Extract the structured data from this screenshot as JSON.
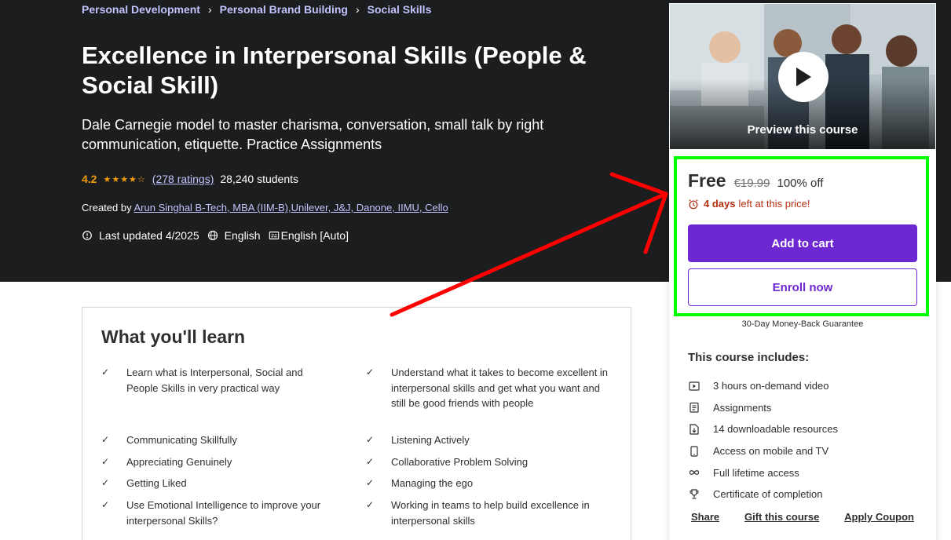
{
  "breadcrumbs": [
    "Personal Development",
    "Personal Brand Building",
    "Social Skills"
  ],
  "course": {
    "title": "Excellence in Interpersonal Skills (People & Social Skill)",
    "subtitle": "Dale Carnegie model to master charisma, conversation, small talk by right communication, etiquette. Practice Assignments",
    "rating": "4.2",
    "stars_value": 4.2,
    "ratings_count": "(278 ratings)",
    "students": "28,240 students",
    "created_by_label": "Created by",
    "instructor": "Arun Singhal B-Tech, MBA (IIM-B),Unilever, J&J, Danone, IIMU, Cello",
    "last_updated": "Last updated 4/2025",
    "language": "English",
    "captions": "English [Auto]"
  },
  "sidebar": {
    "preview_label": "Preview this course",
    "price_now": "Free",
    "price_old": "€19.99",
    "discount": "100% off",
    "timer_bold": "4 days",
    "timer_rest": "left at this price!",
    "add_to_cart": "Add to cart",
    "enroll_now": "Enroll now",
    "guarantee": "30-Day Money-Back Guarantee",
    "includes_title": "This course includes:",
    "includes": [
      {
        "icon": "video-icon",
        "label": "3 hours on-demand video"
      },
      {
        "icon": "assignment-icon",
        "label": "Assignments"
      },
      {
        "icon": "download-file-icon",
        "label": "14 downloadable resources"
      },
      {
        "icon": "mobile-icon",
        "label": "Access on mobile and TV"
      },
      {
        "icon": "infinity-icon",
        "label": "Full lifetime access"
      },
      {
        "icon": "trophy-icon",
        "label": "Certificate of completion"
      }
    ],
    "links": {
      "share": "Share",
      "gift": "Gift this course",
      "coupon": "Apply Coupon"
    }
  },
  "learn": {
    "title": "What you'll learn",
    "items": [
      "Learn what is Interpersonal, Social and People Skills in very practical way",
      "Understand what it takes to become excellent in interpersonal skills and get what you want and still be good friends with people",
      "Communicating Skillfully",
      "Listening Actively",
      "Appreciating Genuinely",
      "Collaborative Problem Solving",
      "Getting Liked",
      "Managing the ego",
      "Use Emotional Intelligence to improve your interpersonal Skills?",
      "Working in teams to help build excellence in interpersonal skills"
    ]
  },
  "colors": {
    "hero_bg": "#1c1d1f",
    "accent_purple": "#6d28d2",
    "link_lavender": "#c0c4fc",
    "star_orange": "#f69c08",
    "timer_red": "#b32d0f",
    "annotation_green": "#00ff00",
    "annotation_red": "#ff0000"
  }
}
